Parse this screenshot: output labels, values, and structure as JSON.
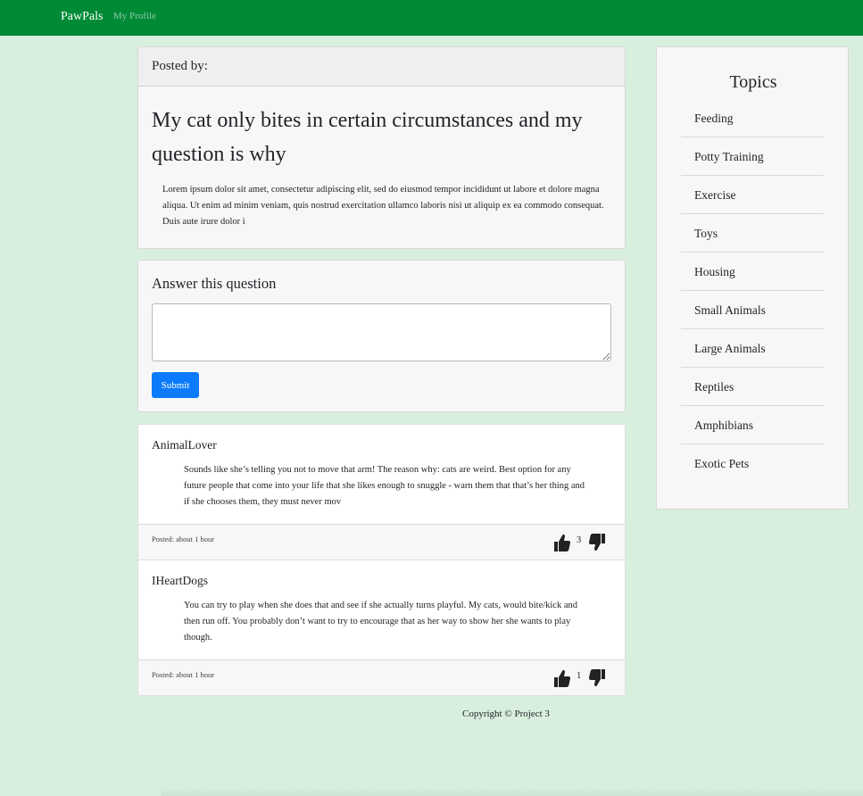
{
  "navbar": {
    "brand": "PawPals",
    "profile_link": "My Profile"
  },
  "question": {
    "posted_by": "Posted by:",
    "title": "My cat only bites in certain circumstances and my question is why",
    "body": "Lorem ipsum dolor sit amet, consectetur adipiscing elit, sed do eiusmod tempor incididunt ut labore et dolore magna aliqua. Ut enim ad minim veniam, quis nostrud exercitation ullamco laboris nisi ut aliquip ex ea commodo consequat. Duis aute irure dolor i"
  },
  "answer_form": {
    "title": "Answer this question",
    "textarea_value": "",
    "submit_label": "Submit"
  },
  "answers": [
    {
      "author": "AnimalLover",
      "body": "Sounds like she’s telling you not to move that arm! The reason why: cats are weird. Best option for any future people that come into your life that she likes enough to snuggle - warn them that that’s her thing and if she chooses them, they must never mov",
      "posted": "Posted: about 1 hour",
      "votes": "3"
    },
    {
      "author": "IHeartDogs",
      "body": "You can try to play when she does that and see if she actually turns playful. My cats, would bite/kick and then run off. You probably don’t want to try to encourage that as her way to show her she wants to play though.",
      "posted": "Posted: about 1 hour",
      "votes": "1"
    }
  ],
  "topics": {
    "title": "Topics",
    "items": [
      "Feeding",
      "Potty Training",
      "Exercise",
      "Toys",
      "Housing",
      "Small Animals",
      "Large Animals",
      "Reptiles",
      "Amphibians",
      "Exotic Pets"
    ]
  },
  "footer": {
    "copyright": "Copyright © Project 3"
  },
  "colors": {
    "navbar": "#008a36",
    "background": "#d8efde",
    "submit_button": "#0b7bfb"
  },
  "icons": {
    "upvote": "thumbs-up-icon",
    "downvote": "thumbs-down-icon"
  }
}
